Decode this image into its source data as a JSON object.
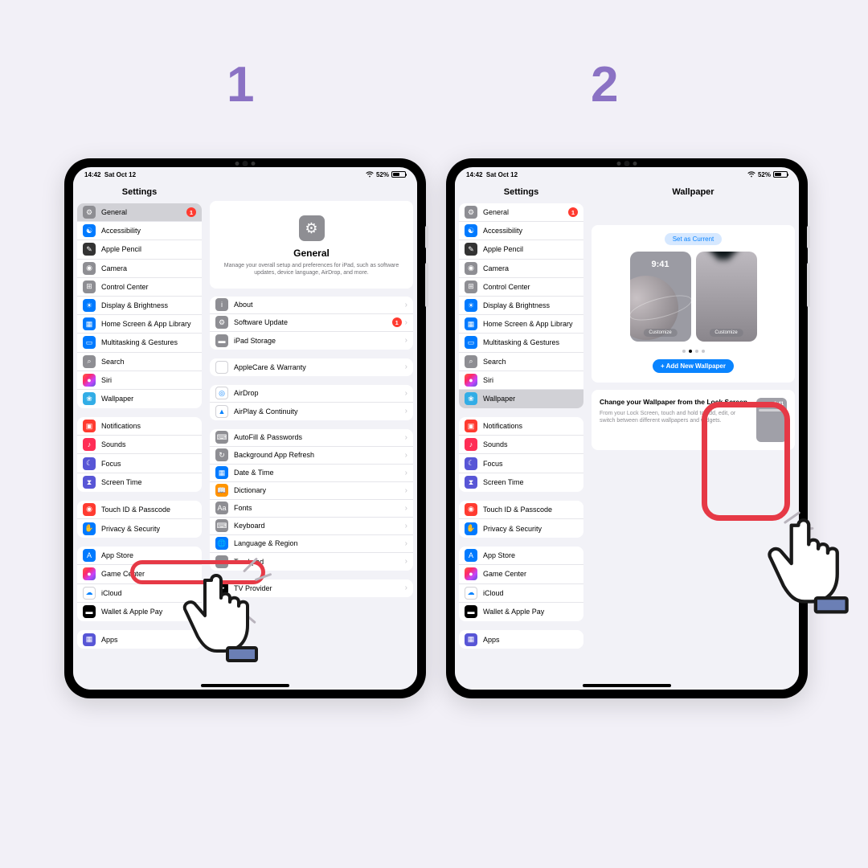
{
  "steps": {
    "one": "1",
    "two": "2"
  },
  "status": {
    "time": "14:42",
    "date": "Sat Oct 12",
    "battery": "52%"
  },
  "settings_title": "Settings",
  "sidebar": {
    "items": [
      {
        "label": "General",
        "badge": "1"
      },
      {
        "label": "Accessibility"
      },
      {
        "label": "Apple Pencil"
      },
      {
        "label": "Camera"
      },
      {
        "label": "Control Center"
      },
      {
        "label": "Display & Brightness"
      },
      {
        "label": "Home Screen & App Library"
      },
      {
        "label": "Multitasking & Gestures"
      },
      {
        "label": "Search"
      },
      {
        "label": "Siri"
      },
      {
        "label": "Wallpaper"
      }
    ],
    "g2": [
      {
        "label": "Notifications"
      },
      {
        "label": "Sounds"
      },
      {
        "label": "Focus"
      },
      {
        "label": "Screen Time"
      }
    ],
    "g3": [
      {
        "label": "Touch ID & Passcode"
      },
      {
        "label": "Privacy & Security"
      }
    ],
    "g4": [
      {
        "label": "App Store"
      },
      {
        "label": "Game Center"
      },
      {
        "label": "iCloud"
      },
      {
        "label": "Wallet & Apple Pay"
      }
    ],
    "g5": [
      {
        "label": "Apps"
      }
    ]
  },
  "general": {
    "title": "General",
    "desc": "Manage your overall setup and preferences for iPad, such as software updates, device language, AirDrop, and more.",
    "g1": [
      {
        "label": "About"
      },
      {
        "label": "Software Update",
        "badge": "1"
      },
      {
        "label": "iPad Storage"
      }
    ],
    "g2": [
      {
        "label": "AppleCare & Warranty"
      }
    ],
    "g3": [
      {
        "label": "AirDrop"
      },
      {
        "label": "AirPlay & Continuity"
      }
    ],
    "g4": [
      {
        "label": "AutoFill & Passwords"
      },
      {
        "label": "Background App Refresh"
      },
      {
        "label": "Date & Time"
      },
      {
        "label": "Dictionary"
      },
      {
        "label": "Fonts"
      },
      {
        "label": "Keyboard"
      },
      {
        "label": "Language & Region"
      },
      {
        "label": "Trackpad"
      }
    ],
    "g5": [
      {
        "label": "TV Provider"
      }
    ]
  },
  "wallpaper": {
    "title": "Wallpaper",
    "set": "Set as Current",
    "time": "9:41",
    "cust": "Customize",
    "add": "+ Add New Wallpaper",
    "info_t": "Change your Wallpaper from the Lock Screen",
    "info_d": "From your Lock Screen, touch and hold to add, edit, or switch between different wallpapers and widgets.",
    "mini_t": "9:41"
  }
}
